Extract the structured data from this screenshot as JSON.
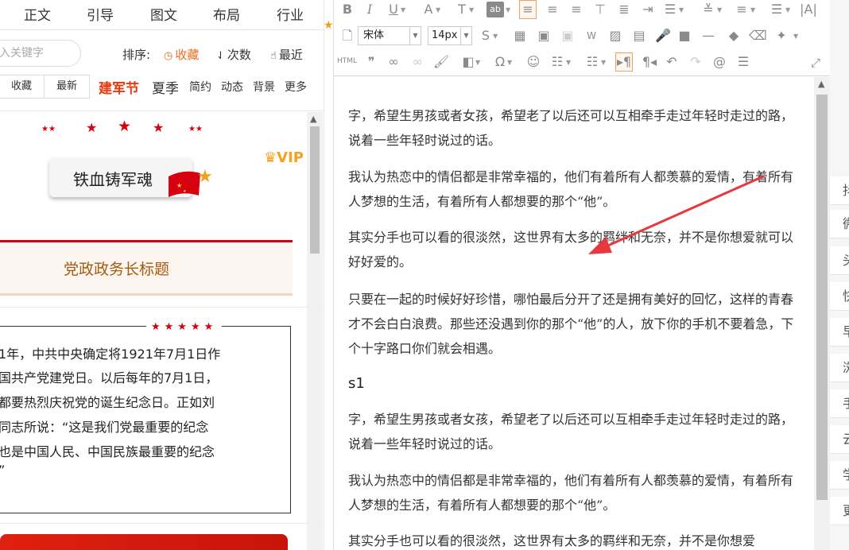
{
  "left_panel": {
    "nav": [
      "正文",
      "引导",
      "图文",
      "布局",
      "行业"
    ],
    "search_placeholder": "入关键字",
    "sort_label": "排序:",
    "sort_options": [
      "收藏",
      "次数",
      "最近"
    ],
    "tab_buttons": [
      "收藏",
      "最新"
    ],
    "tags": [
      "建军节",
      "夏季",
      "简约",
      "动态",
      "背景",
      "更多"
    ],
    "vip": "VIP",
    "badge_text": "铁血铸军魂",
    "title_text": "党政政务长标题",
    "quote_stars": "★★★★★",
    "quote_lines": [
      "1年，中共中央确定将1921年7月1日作",
      "国共产党建党日。以后每年的7月1日，",
      "都要热烈庆祝党的诞生纪念日。正如刘",
      "同志所说：“这是我们党最重要的纪念",
      "也是中国人民、中国民族最重要的纪念",
      "”"
    ]
  },
  "editor": {
    "font_name": "宋体",
    "font_size": "14px",
    "html_label": "HTML",
    "paragraphs": [
      "字，希望生男孩或者女孩，希望老了以后还可以互相牵手走过年轻时走过的路，说着一些年轻时说过的话。",
      "我认为热恋中的情侣都是非常幸福的，他们有着所有人都羡慕的爱情，有着所有人梦想的生活，有着所有人都想要的那个“他”。",
      "其实分手也可以看的很淡然，这世界有太多的羁绊和无奈，并不是你想爱就可以好好爱的。",
      "只要在一起的时候好好珍惜，哪怕最后分开了还是拥有美好的回忆，这样的青春才不会白白浪费。那些还没遇到你的那个“他”的人，放下你的手机不要着急，下个十字路口你们就会相遇。"
    ],
    "heading": "s1",
    "paragraphs_2": [
      "字，希望生男孩或者女孩，希望老了以后还可以互相牵手走过年轻时走过的路，说着一些年轻时说过的话。",
      "我认为热恋中的情侣都是非常幸福的，他们有着所有人都羡慕的爱情，有着所有人梦想的生活，有着所有人都想要的那个“他”。",
      "其实分手也可以看的很淡然，这世界有太多的羁绊和无奈，并不是你想爱"
    ]
  },
  "right_strip": [
    "抖",
    "微",
    "头",
    "快",
    "早",
    "浏",
    "手",
    "云",
    "学",
    "更"
  ],
  "colors": {
    "accent_red": "#d7000f",
    "accent_orange": "#f06a1e",
    "annotation_arrow": "#e8383d"
  }
}
